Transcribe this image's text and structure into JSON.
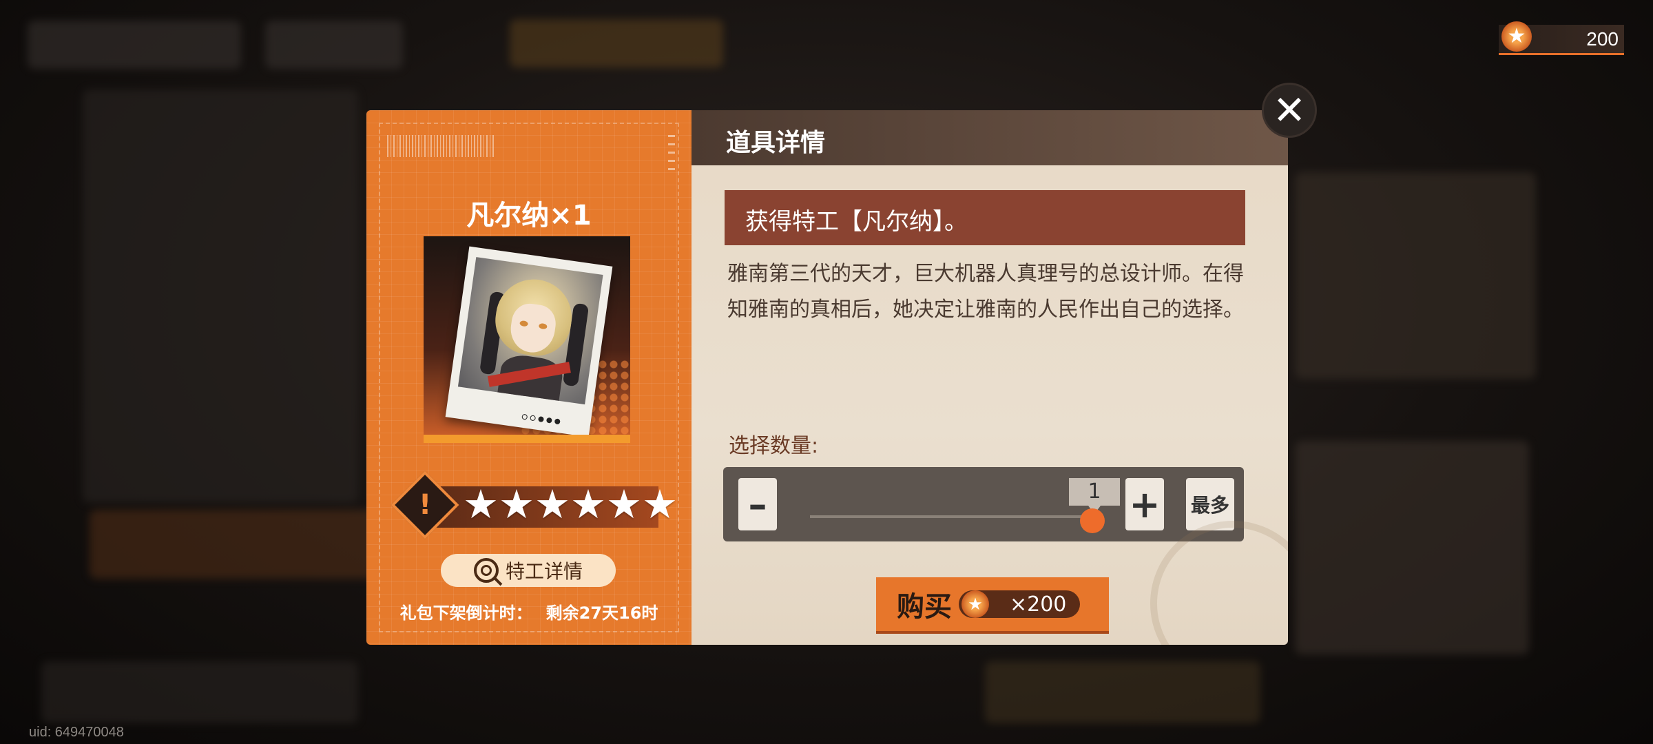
{
  "currency": {
    "icon": "star-coin-icon",
    "value": "200"
  },
  "dialog": {
    "header_title": "道具详情",
    "item_name": "凡尔纳×1",
    "rank_icon": "rank-s-icon",
    "rank_glyph": "!",
    "stars": "★★★★★★",
    "agent_detail_label": "特工详情",
    "countdown_label": "礼包下架倒计时：",
    "countdown_value": "剩余27天16时",
    "effect_text": "获得特工【凡尔纳】。",
    "description": "雅南第三代的天才，巨大机器人真理号的总设计师。在得知雅南的真相后，她决定让雅南的人民作出自己的选择。",
    "quantity_label": "选择数量:",
    "quantity_value": "1",
    "minus_label": "–",
    "plus_label": "+",
    "max_label": "最多",
    "buy_label": "购买",
    "price": "×200",
    "close_icon": "close-icon",
    "close_glyph": "✕"
  },
  "uid": "uid: 649470048",
  "colors": {
    "accent": "#e67a2c",
    "panel": "#e7d9c6",
    "banner": "#8a4331"
  }
}
